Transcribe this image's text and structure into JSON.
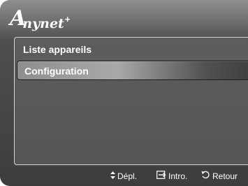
{
  "header": {
    "logo_main": "Anynet",
    "logo_plus": "+"
  },
  "panel": {
    "title": "Liste appareils",
    "items": [
      {
        "label": "Configuration",
        "selected": true
      }
    ]
  },
  "footer": {
    "move": {
      "icon": "up-down-arrows-icon",
      "label": "Dépl."
    },
    "enter": {
      "icon": "enter-icon",
      "label": "Intro."
    },
    "return": {
      "icon": "return-icon",
      "label": "Retour"
    }
  },
  "colors": {
    "text": "#ffffff",
    "panel_border": "#d6d6d6",
    "background_dark": "#3d3d3d"
  }
}
